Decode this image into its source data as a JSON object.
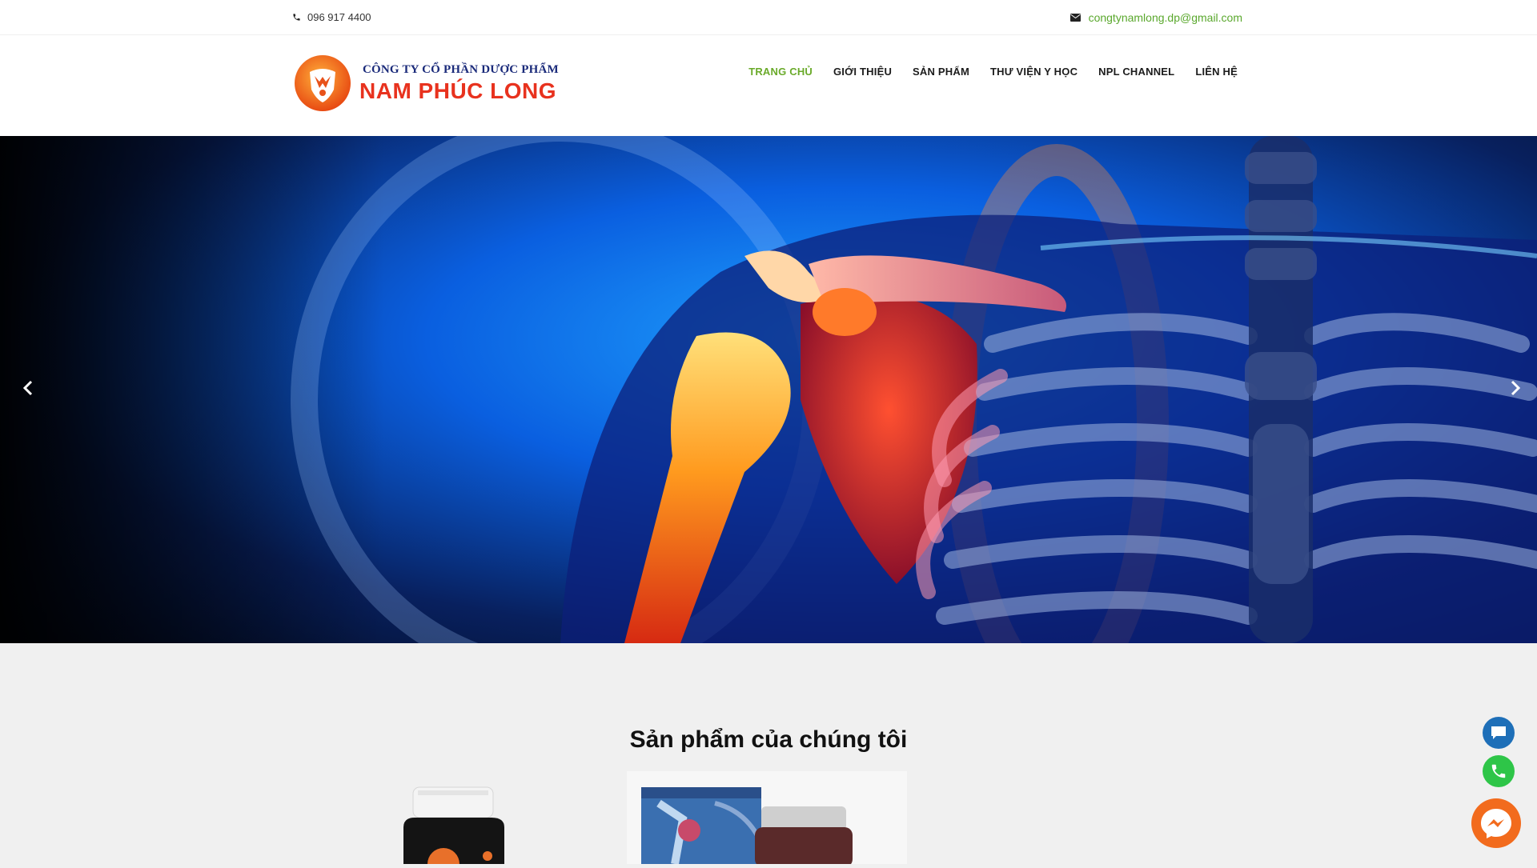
{
  "topbar": {
    "phone": "096 917 4400",
    "email": "congtynamlong.dp@gmail.com",
    "phone_icon": "phone-icon",
    "email_icon": "envelope-icon"
  },
  "brand": {
    "line1": "CÔNG TY CỔ PHẦN DƯỢC PHẨM",
    "line2": "NAM PHÚC LONG",
    "logo_icon": "orange-shield-logo"
  },
  "nav": {
    "items": [
      {
        "label": "TRANG CHỦ",
        "active": true
      },
      {
        "label": "GIỚI THIỆU",
        "active": false
      },
      {
        "label": "SẢN PHẨM",
        "active": false
      },
      {
        "label": "THƯ VIỆN Y HỌC",
        "active": false
      },
      {
        "label": "NPL CHANNEL",
        "active": false
      },
      {
        "label": "LIÊN HỆ",
        "active": false
      }
    ]
  },
  "hero": {
    "prev_icon": "chevron-left-icon",
    "next_icon": "chevron-right-icon"
  },
  "products": {
    "title": "Sản phẩm của chúng tôi"
  },
  "floating": {
    "chat_icon": "chat-bubble-icon",
    "phone_icon": "phone-icon",
    "messenger_icon": "messenger-icon"
  },
  "colors": {
    "accent_green": "#6aaa2a",
    "brand_red": "#e8321e",
    "brand_navy": "#1a2a7a",
    "messenger_orange": "#f26b1d",
    "phone_green": "#2ec548",
    "chat_blue": "#1e6fb8"
  }
}
